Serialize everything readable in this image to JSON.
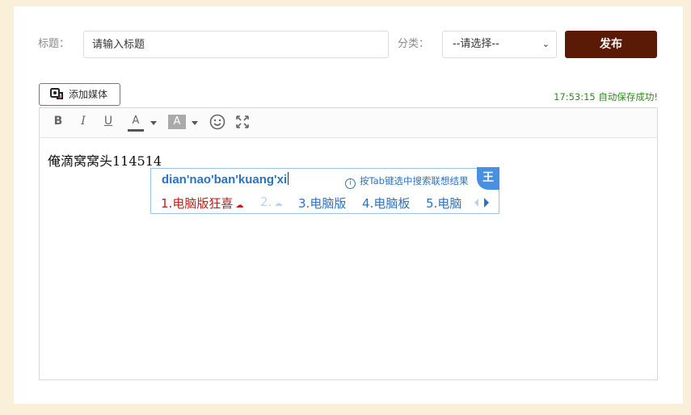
{
  "form": {
    "title_label": "标题：",
    "title_placeholder": "请输入标题",
    "category_label": "分类：",
    "category_selected": "--请选择--",
    "publish_label": "发布"
  },
  "media": {
    "add_media_label": "添加媒体"
  },
  "status": {
    "autosave": "17:53:15 自动保存成功!"
  },
  "toolbar": {
    "bold": "B",
    "italic": "I",
    "underline": "U",
    "font_color": "A",
    "bg_color": "A"
  },
  "editor": {
    "content": "俺滴窝窝头114514"
  },
  "ime": {
    "pinyin": "dian'nao'ban'kuang'xi",
    "hint": "按Tab键选中搜索联想结果",
    "logo": "王",
    "candidates": [
      {
        "index": "1.",
        "text": "电脑版狂喜"
      },
      {
        "index": "2.",
        "text": ""
      },
      {
        "index": "3.",
        "text": "电脑版"
      },
      {
        "index": "4.",
        "text": "电脑板"
      },
      {
        "index": "5.",
        "text": "电脑"
      }
    ]
  }
}
